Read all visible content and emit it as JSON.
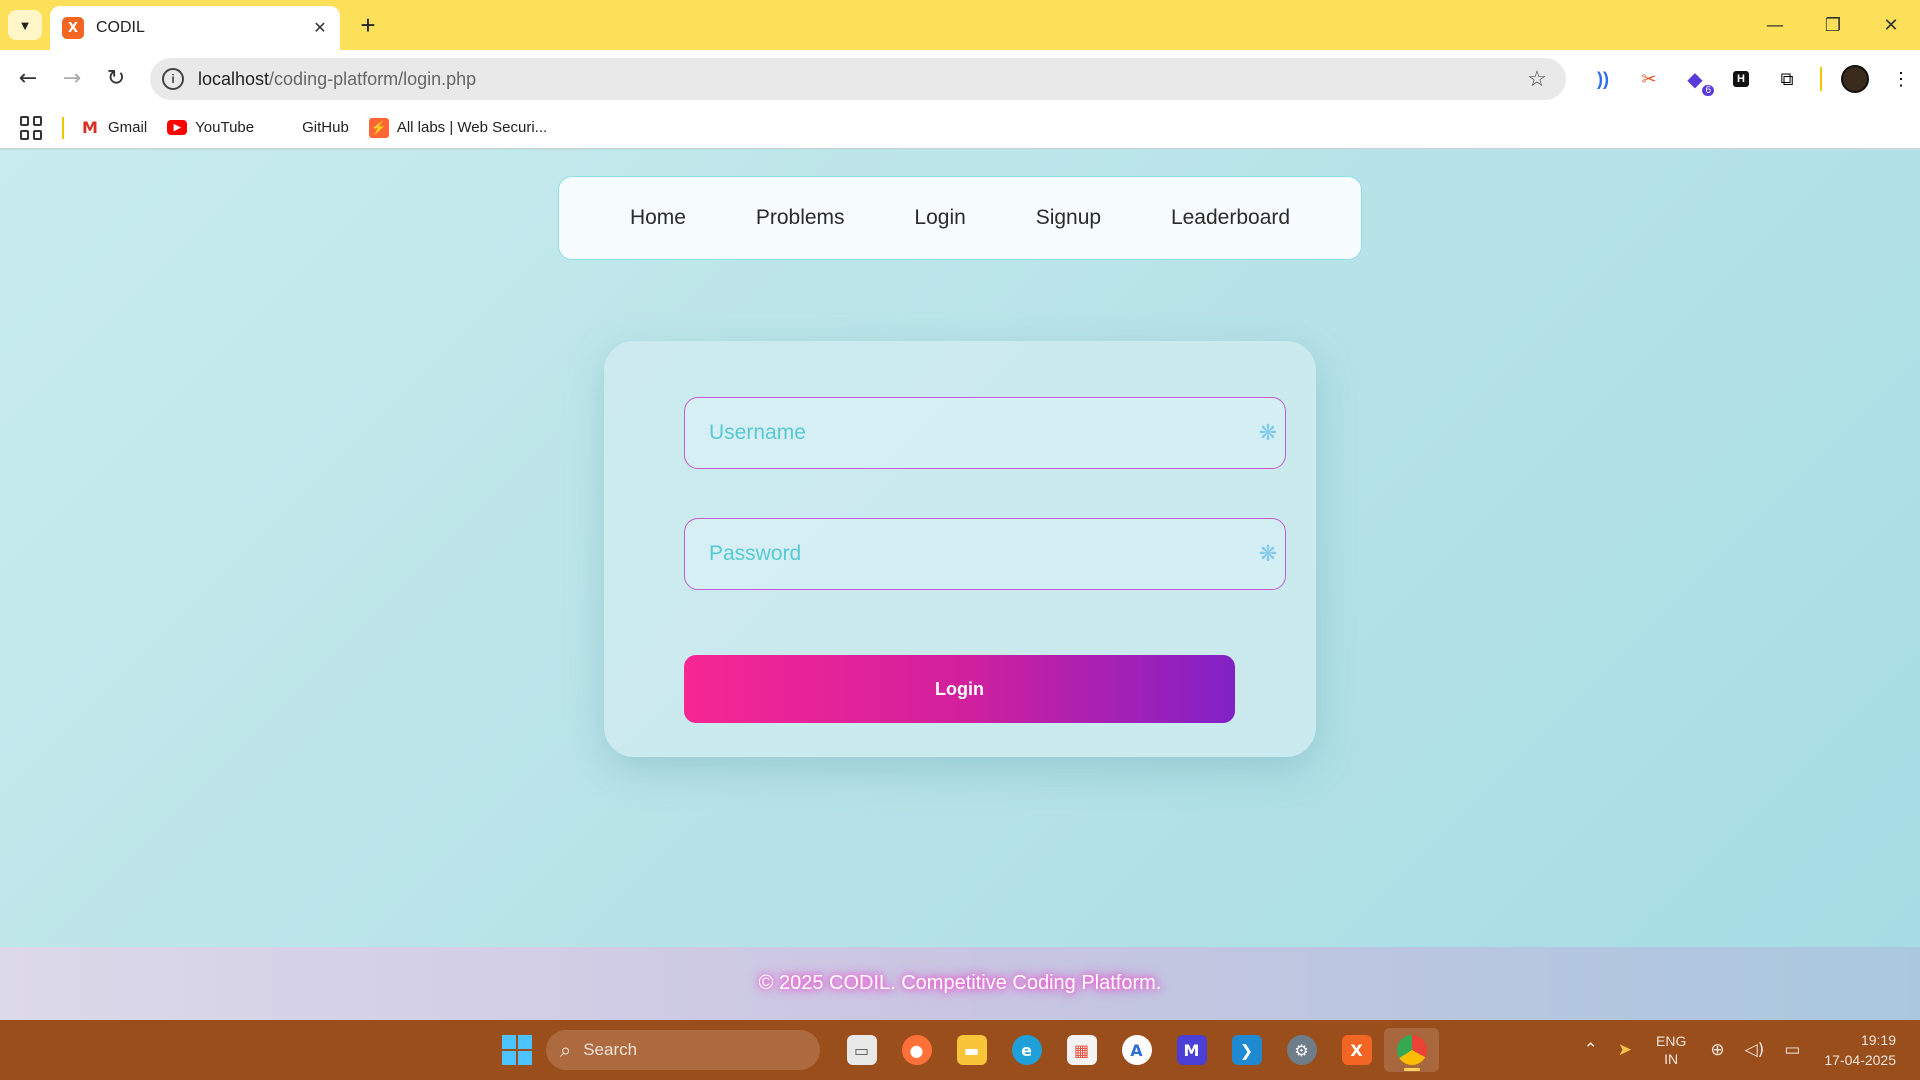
{
  "browser": {
    "tab_title": "CODIL",
    "tab_favicon": "X",
    "url_host": "localhost",
    "url_path": "/coding-platform/login.php",
    "bookmarks": [
      {
        "label": "Gmail",
        "icon": "gmail-icon"
      },
      {
        "label": "YouTube",
        "icon": "youtube-icon"
      },
      {
        "label": "GitHub",
        "icon": "github-icon"
      },
      {
        "label": "All labs | Web Securi...",
        "icon": "portswigger-icon"
      }
    ],
    "extension_badge": "6"
  },
  "nav": {
    "items": [
      "Home",
      "Problems",
      "Login",
      "Signup",
      "Leaderboard"
    ]
  },
  "login_form": {
    "username_placeholder": "Username",
    "password_placeholder": "Password",
    "submit_label": "Login"
  },
  "footer": {
    "text": "© 2025 CODIL. Competitive Coding Platform."
  },
  "taskbar": {
    "search_label": "Search",
    "lang_line1": "ENG",
    "lang_line2": "IN",
    "time": "19:19",
    "date": "17-04-2025"
  },
  "colors": {
    "tabstrip": "#fde05a",
    "button_gradient_start": "#f72794",
    "button_gradient_end": "#8221c6",
    "field_border": "#c55bd8",
    "taskbar": "#9a4e1c"
  }
}
